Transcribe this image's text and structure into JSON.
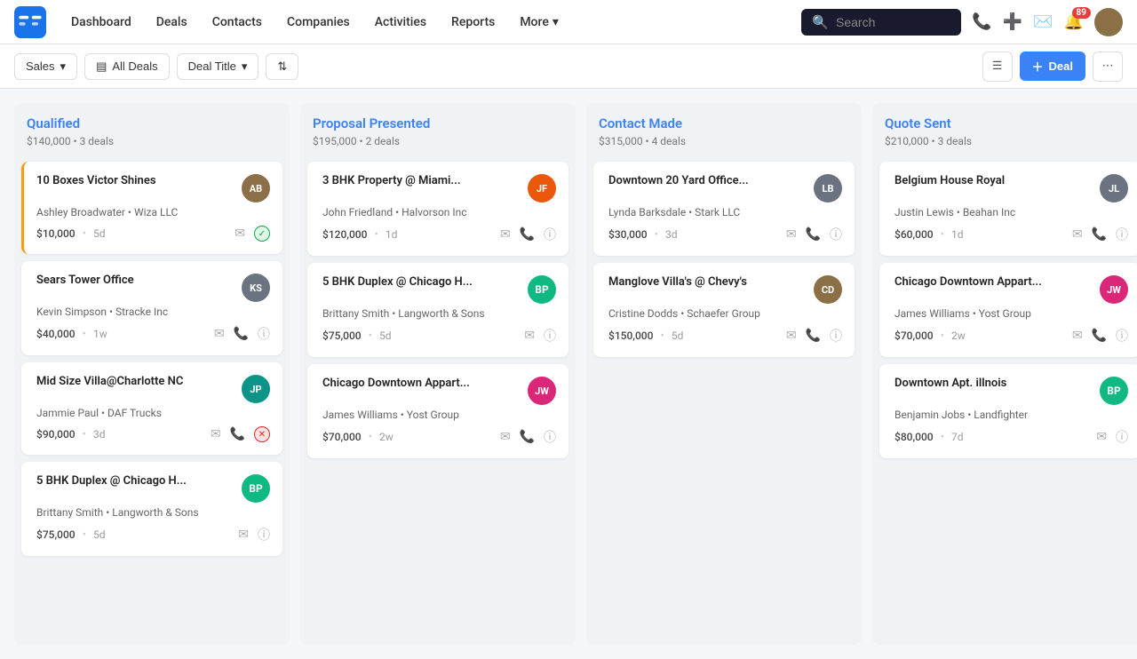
{
  "nav": {
    "logo_label": "CRM",
    "links": [
      "Dashboard",
      "Deals",
      "Contacts",
      "Companies",
      "Activities",
      "Reports"
    ],
    "more_label": "More",
    "search_placeholder": "Search",
    "notification_count": "89"
  },
  "toolbar": {
    "sales_label": "Sales",
    "filter_label": "All Deals",
    "sort_label": "Deal Title",
    "deal_button_label": "Deal",
    "view_list_label": "List view",
    "more_label": "More options"
  },
  "columns": [
    {
      "id": "qualified",
      "title": "Qualified",
      "amount": "$140,000",
      "deals": "3 deals",
      "cards": [
        {
          "title": "10 Boxes Victor Shines",
          "person": "Ashley Broadwater",
          "company": "Wiza LLC",
          "amount": "$10,000",
          "time": "5d",
          "avatar_type": "image",
          "avatar_color": "av-brown",
          "avatar_initials": "AB",
          "highlighted": true,
          "status": "green"
        },
        {
          "title": "Sears Tower Office",
          "person": "Kevin Simpson",
          "company": "Stracke Inc",
          "amount": "$40,000",
          "time": "1w",
          "avatar_type": "image",
          "avatar_color": "av-gray",
          "avatar_initials": "KS",
          "highlighted": false,
          "status": null
        },
        {
          "title": "Mid Size Villa@Charlotte NC",
          "person": "Jammie Paul",
          "company": "DAF Trucks",
          "amount": "$90,000",
          "time": "3d",
          "avatar_type": "image",
          "avatar_color": "av-teal",
          "avatar_initials": "JP",
          "highlighted": false,
          "status": "red"
        },
        {
          "title": "5 BHK Duplex @ Chicago H...",
          "person": "Brittany Smith",
          "company": "Langworth & Sons",
          "amount": "$75,000",
          "time": "5d",
          "avatar_type": "initials",
          "avatar_color": "bp-badge",
          "avatar_initials": "BP",
          "highlighted": false,
          "status": null
        }
      ]
    },
    {
      "id": "proposal",
      "title": "Proposal Presented",
      "amount": "$195,000",
      "deals": "2 deals",
      "cards": [
        {
          "title": "3 BHK Property @ Miami...",
          "person": "John Friedland",
          "company": "Halvorson Inc",
          "amount": "$120,000",
          "time": "1d",
          "avatar_type": "image",
          "avatar_color": "av-orange",
          "avatar_initials": "JF",
          "highlighted": false,
          "status": null
        },
        {
          "title": "5 BHK Duplex @ Chicago H...",
          "person": "Brittany Smith",
          "company": "Langworth & Sons",
          "amount": "$75,000",
          "time": "5d",
          "avatar_type": "initials",
          "avatar_color": "bp-badge",
          "avatar_initials": "BP",
          "highlighted": false,
          "status": null
        },
        {
          "title": "Chicago Downtown Appart...",
          "person": "James Williams",
          "company": "Yost Group",
          "amount": "$70,000",
          "time": "2w",
          "avatar_type": "image",
          "avatar_color": "av-pink",
          "avatar_initials": "JW",
          "highlighted": false,
          "status": null
        }
      ]
    },
    {
      "id": "contact",
      "title": "Contact Made",
      "amount": "$315,000",
      "deals": "4 deals",
      "cards": [
        {
          "title": "Downtown 20 Yard Office...",
          "person": "Lynda Barksdale",
          "company": "Stark LLC",
          "amount": "$30,000",
          "time": "3d",
          "avatar_type": "image",
          "avatar_color": "av-gray",
          "avatar_initials": "LB",
          "highlighted": false,
          "status": null
        },
        {
          "title": "Manglove Villa's @ Chevy's",
          "person": "Cristine Dodds",
          "company": "Schaefer Group",
          "amount": "$150,000",
          "time": "5d",
          "avatar_type": "image",
          "avatar_color": "av-brown",
          "avatar_initials": "CD",
          "highlighted": false,
          "status": null
        }
      ]
    },
    {
      "id": "quote",
      "title": "Quote Sent",
      "amount": "$210,000",
      "deals": "3 deals",
      "cards": [
        {
          "title": "Belgium House Royal",
          "person": "Justin Lewis",
          "company": "Beahan Inc",
          "amount": "$60,000",
          "time": "1d",
          "avatar_type": "image",
          "avatar_color": "av-gray",
          "avatar_initials": "JL",
          "highlighted": false,
          "status": null
        },
        {
          "title": "Chicago Downtown Appart...",
          "person": "James Williams",
          "company": "Yost Group",
          "amount": "$70,000",
          "time": "2w",
          "avatar_type": "image",
          "avatar_color": "av-pink",
          "avatar_initials": "JW",
          "highlighted": false,
          "status": null
        },
        {
          "title": "Downtown Apt. illnois",
          "person": "Benjamin Jobs",
          "company": "Landfighter",
          "amount": "$80,000",
          "time": "7d",
          "avatar_type": "initials",
          "avatar_color": "bp-badge",
          "avatar_initials": "BP",
          "highlighted": false,
          "status": null
        }
      ]
    }
  ]
}
